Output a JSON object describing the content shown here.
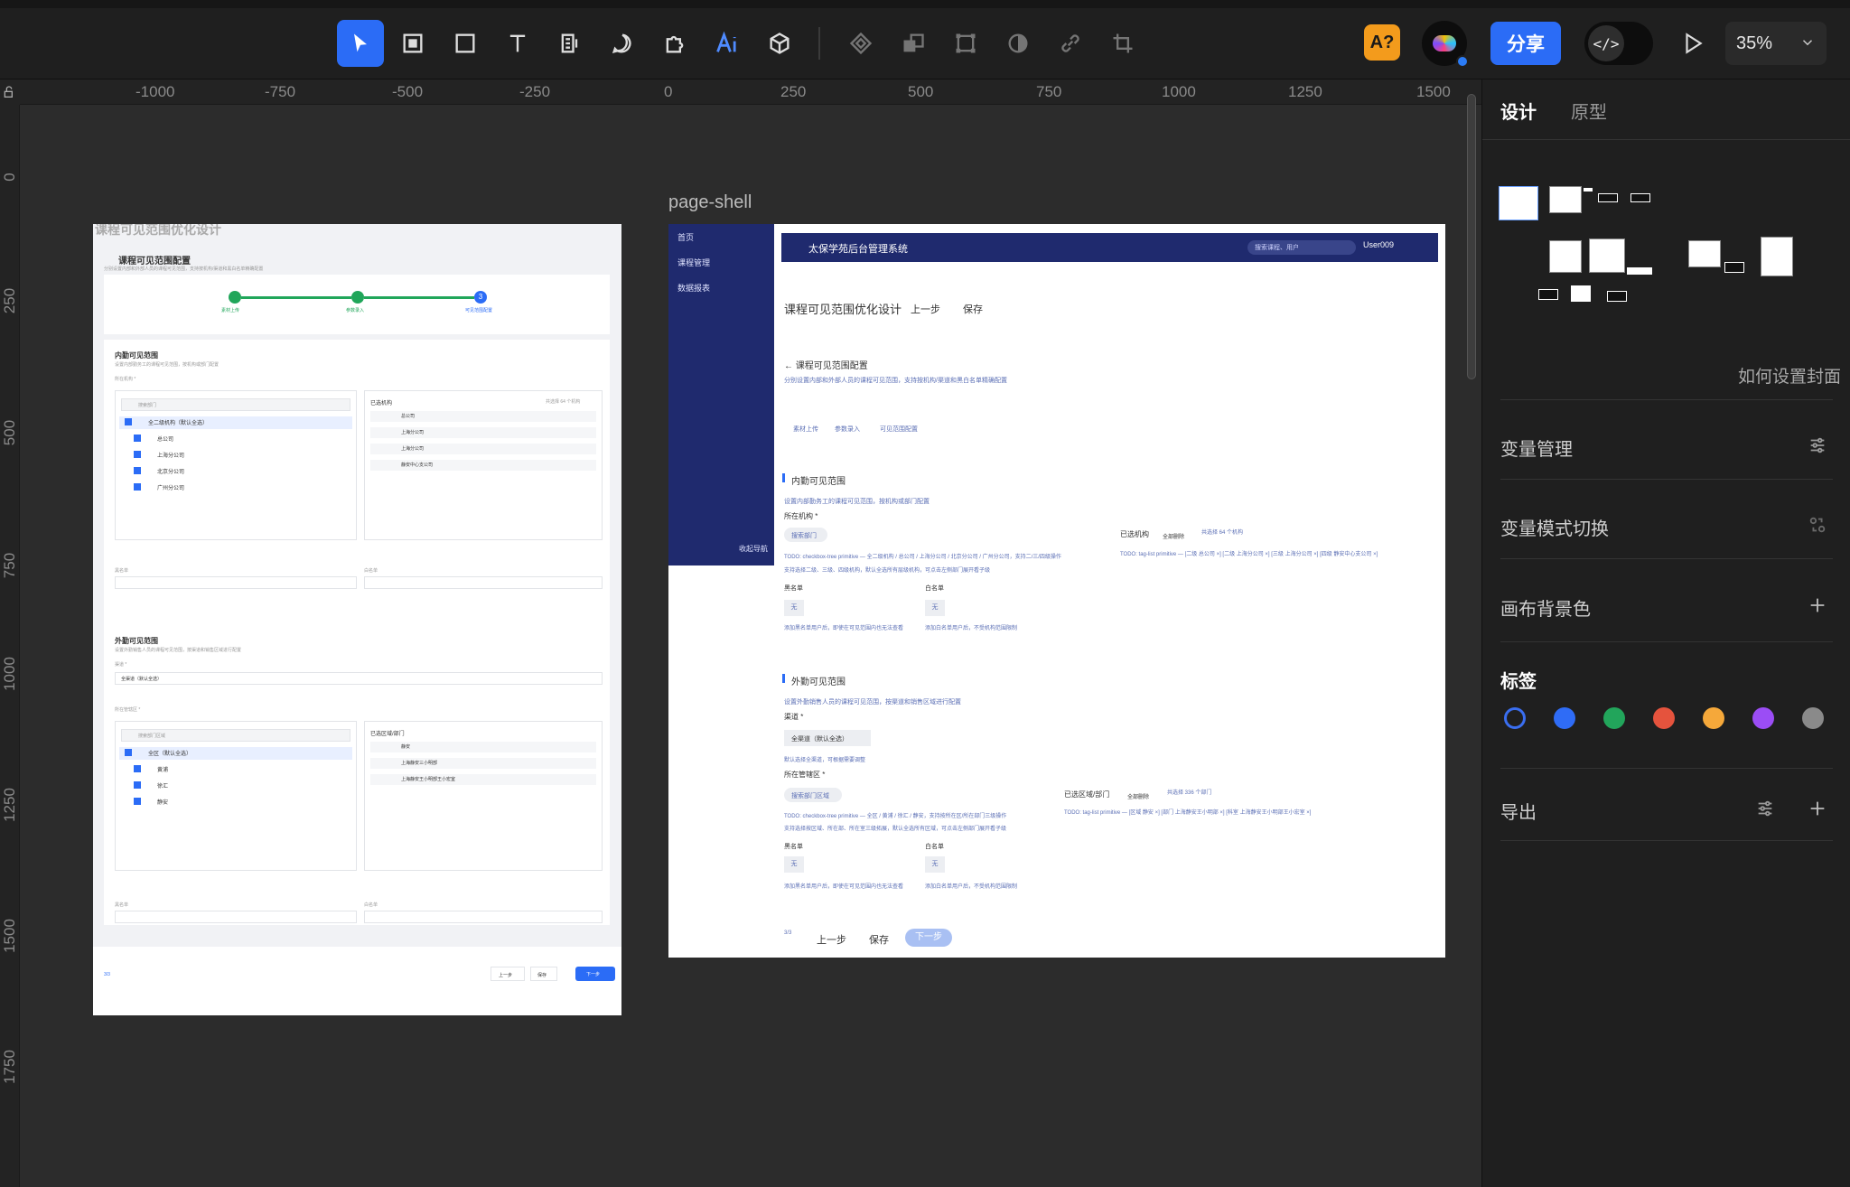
{
  "toolbar": {
    "tools": [
      {
        "name": "select-tool",
        "active": true
      },
      {
        "name": "frame-tool"
      },
      {
        "name": "rectangle-tool"
      },
      {
        "name": "text-tool"
      },
      {
        "name": "text-block-tool"
      },
      {
        "name": "comment-tool"
      },
      {
        "name": "plugin-tool"
      },
      {
        "name": "ai-tool"
      },
      {
        "name": "3d-tool"
      },
      {
        "name": "component-tool",
        "disabled": true
      },
      {
        "name": "boolean-tool",
        "disabled": true
      },
      {
        "name": "transform-tool",
        "disabled": true
      },
      {
        "name": "mask-tool",
        "disabled": true
      },
      {
        "name": "link-tool",
        "disabled": true
      },
      {
        "name": "crop-tool",
        "disabled": true
      }
    ],
    "ai_badge": "A?",
    "share_label": "分享",
    "code_toggle_icon": "</>",
    "zoom": "35%"
  },
  "canvas": {
    "ruler_h": [
      "-1000",
      "-750",
      "-500",
      "-250",
      "0",
      "250",
      "500",
      "750",
      "1000",
      "1250",
      "1500"
    ],
    "ruler_v": [
      "0",
      "250",
      "500",
      "750",
      "1000",
      "1250",
      "1500",
      "1750"
    ],
    "frame_b_label": "page-shell",
    "frame_a": {
      "title": "课程可见范围优化设计",
      "heading": "课程可见范围配置",
      "subtitle": "分别设置内部和外部人员的课程可见范围，支持按机构/渠道和黑白名单精确配置",
      "steps": [
        "素材上传",
        "参数录入",
        "可见范围配置"
      ],
      "step3_num": "3",
      "internal_title": "内勤可见范围",
      "internal_desc": "设置内部勤务工的课程可见范围，按机构或部门配置",
      "org_label": "所在机构 *",
      "search_dept": "搜索部门",
      "tree_items": [
        "全二级机构（默认全选）",
        "总公司",
        "上海分公司",
        "北京分公司",
        "广州分公司"
      ],
      "selected_title": "已选机构",
      "selected_count": "共选择 64 个机构",
      "selected_items": [
        "总公司",
        "上海分公司",
        "上海分公司",
        "静安中心支公司"
      ],
      "blacklist": "黑名单",
      "whitelist": "白名单",
      "external_title": "外勤可见范围",
      "external_desc": "设置外勤销售人员的课程可见范围，按渠道和销售区域进行配置",
      "channel_label": "渠道 *",
      "channel_value": "全渠道（默认全选）",
      "region_label": "所在管辖区 *",
      "search_region": "搜索部门区域",
      "region_tree": [
        "全区（默认全选）",
        "黄浦",
        "徐汇",
        "静安"
      ],
      "region_selected_title": "已选区域/部门",
      "region_selected": [
        "静安",
        "上海静安三小明部",
        "上海静安王小明部王小宏室"
      ],
      "footer_page": "3/3",
      "footer_prev": "上一步",
      "footer_save": "保存",
      "footer_next": "下一步"
    },
    "frame_b": {
      "sidebar": [
        "首页",
        "课程管理",
        "数据报表"
      ],
      "collapse": "收起导航",
      "app_title": "太保学苑后台管理系统",
      "search_placeholder": "搜索课程、用户",
      "user": "User009",
      "page_title": "课程可见范围优化设计",
      "prev": "上一步",
      "save": "保存",
      "back_heading": "← 课程可见范围配置",
      "back_desc": "分别设置内部和外部人员的课程可见范围，支持按机构/渠道和黑白名单精确配置",
      "steps": [
        "素材上传",
        "参数录入",
        "可见范围配置"
      ],
      "internal_title": "内勤可见范围",
      "internal_desc": "设置内部勤务工的课程可见范围，按机构或部门配置",
      "org_label": "所在机构 *",
      "search_dept": "搜索部门",
      "selected_org": "已选机构",
      "select_all": "全部删除",
      "org_count": "共选择 64 个机构",
      "todo_tree": "TODO: checkbox-tree primitive — 全二级机构 / 总公司 / 上海分公司 / 北京分公司 / 广州分公司，支持二/三/四级操作",
      "todo_tree_2": "支持选择二级、三级、四级机构，默认全选所有层级机构，可点击左侧部门展开看子级",
      "todo_tags": "TODO: tag-list primitive — [二级 总公司 ×] [二级 上海分公司 ×] [三级 上海分公司 ×] [四级 静安中心支公司 ×]",
      "blacklist": "黑名单",
      "whitelist": "白名单",
      "none": "无",
      "black_hint": "添加黑名单用户后，即使在可见范围内也无法查看",
      "white_hint": "添加白名单用户后，不受机构范围限制",
      "external_title": "外勤可见范围",
      "external_desc": "设置外勤销售人员的课程可见范围，按渠道和销售区域进行配置",
      "channel_label": "渠道 *",
      "channel_value": "全渠道（默认全选）",
      "channel_hint": "默认选择全渠道，可根据需要调整",
      "region_label": "所在管辖区 *",
      "search_region": "搜索部门区域",
      "selected_region": "已选区域/部门",
      "region_select_all": "全部删除",
      "region_count": "共选择 336 个部门",
      "todo_region_tree": "TODO: checkbox-tree primitive — 全区 / 黄浦 / 徐汇 / 静安，支持按所在区/所在部门三级操作",
      "todo_region_tree_2": "支持选择按区域、所在部、所在室三级拓展，默认全选所有区域，可点击左侧部门展开看子级",
      "todo_region_tags": "TODO: tag-list primitive — [区域 静安 ×] [部门 上海静安王小明部 ×] [科室 上海静安王小明部王小宏室 ×]",
      "footer_page": "3/3",
      "footer_prev": "上一步",
      "footer_save": "保存",
      "footer_next": "下一步"
    }
  },
  "panel": {
    "tab_design": "设计",
    "tab_prototype": "原型",
    "cover_hint": "如何设置封面",
    "variables": "变量管理",
    "variable_mode": "变量模式切换",
    "canvas_bg": "画布背景色",
    "tags": "标签",
    "export": "导出",
    "tag_colors": [
      "#1f1f1f",
      "#2f6cf6",
      "#22a55b",
      "#e5533d",
      "#f5a83a",
      "#9b4df5",
      "#8a8a8a"
    ]
  }
}
